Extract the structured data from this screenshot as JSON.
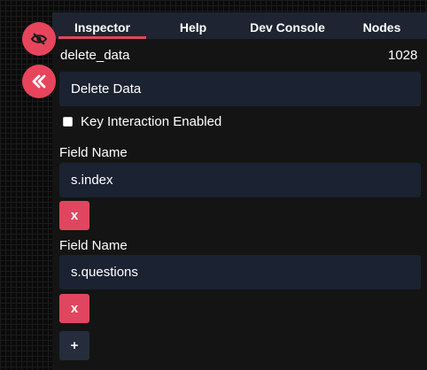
{
  "tabs": [
    {
      "label": "Inspector",
      "active": true
    },
    {
      "label": "Help",
      "active": false
    },
    {
      "label": "Dev Console",
      "active": false
    },
    {
      "label": "Nodes",
      "active": false
    }
  ],
  "side_buttons": {
    "hide_icon": "eye-slash-icon",
    "collapse_icon": "double-chevron-left-icon"
  },
  "node": {
    "name": "delete_data",
    "id": "1028",
    "title_value": "Delete Data"
  },
  "key_interaction": {
    "label": "Key Interaction Enabled",
    "checked": false
  },
  "fields": [
    {
      "label": "Field Name",
      "value": "s.index",
      "remove_label": "x"
    },
    {
      "label": "Field Name",
      "value": "s.questions",
      "remove_label": "x"
    }
  ],
  "add_label": "+",
  "colors": {
    "accent": "#e0465f",
    "field_bg": "#1b2231",
    "tab_bar_bg": "#1e2431"
  }
}
